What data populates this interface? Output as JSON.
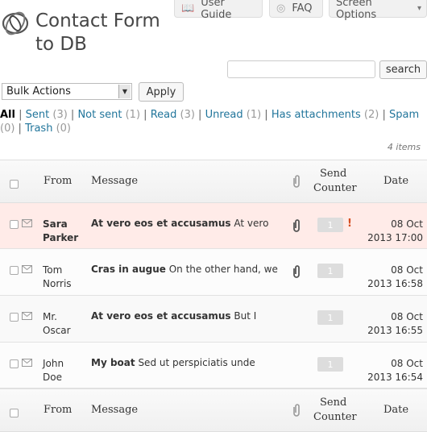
{
  "header_buttons": {
    "user_guide": "User Guide",
    "faq": "FAQ",
    "screen_options": "Screen Options"
  },
  "page": {
    "title": "Contact Form to DB"
  },
  "search": {
    "value": "",
    "placeholder": "",
    "button_label": "search"
  },
  "bulk": {
    "selected": "Bulk Actions",
    "apply_label": "Apply"
  },
  "filters": [
    {
      "label": "All",
      "count": "",
      "current": true
    },
    {
      "label": "Sent",
      "count": "(3)"
    },
    {
      "label": "Not sent",
      "count": "(1)"
    },
    {
      "label": "Read",
      "count": "(3)"
    },
    {
      "label": "Unread",
      "count": "(1)"
    },
    {
      "label": "Has attachments",
      "count": "(2)"
    },
    {
      "label": "Spam",
      "count": "(0)"
    },
    {
      "label": "Trash",
      "count": "(0)"
    }
  ],
  "items_count": "4 items",
  "table": {
    "columns": {
      "from": "From",
      "message": "Message",
      "send_counter_line1": "Send",
      "send_counter_line2": "Counter",
      "date": "Date"
    },
    "rows": [
      {
        "from_line1": "Sara",
        "from_line2": "Parker",
        "subject": "At vero eos et accusamus",
        "excerpt": "At vero",
        "counter": "1",
        "date_line1": "08 Oct",
        "date_line2": "2013 17:00",
        "unread": true,
        "attachment": true,
        "alert": "!"
      },
      {
        "from_line1": "Tom",
        "from_line2": "Norris",
        "subject": "Cras in augue",
        "excerpt": "On the other hand, we",
        "counter": "1",
        "date_line1": "08 Oct",
        "date_line2": "2013 16:58",
        "unread": false,
        "attachment": true
      },
      {
        "from_line1": "Mr.",
        "from_line2": "Oscar",
        "subject": "At vero eos et accusamus",
        "excerpt": "But I",
        "counter": "1",
        "date_line1": "08 Oct",
        "date_line2": "2013 16:55",
        "unread": false,
        "attachment": false
      },
      {
        "from_line1": "John",
        "from_line2": "Doe",
        "subject": "My boat",
        "excerpt": "Sed ut perspiciatis unde",
        "counter": "1",
        "date_line1": "08 Oct",
        "date_line2": "2013 16:54",
        "unread": false,
        "attachment": false
      }
    ]
  },
  "icons": {
    "user_guide": "book-icon",
    "faq": "lifebuoy-icon",
    "attachment": "paperclip-icon",
    "message": "envelope-icon",
    "logo": "swirl-logo-icon"
  },
  "colors": {
    "link": "#21759b",
    "highlight_row": "#ffebe8",
    "alert": "#d54e21"
  }
}
